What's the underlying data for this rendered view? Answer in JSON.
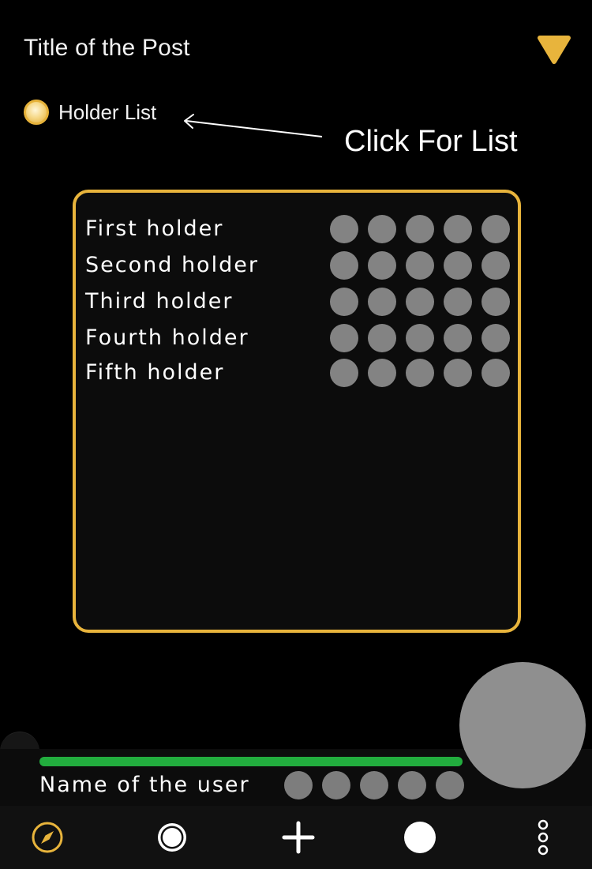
{
  "header": {
    "title": "Title of the Post",
    "dropdown_icon": "triangle-down-icon"
  },
  "holder_toggle": {
    "label": "Holder List",
    "checked": true
  },
  "callout": {
    "text": "Click For List"
  },
  "holders": [
    {
      "name": "First holder"
    },
    {
      "name": "Second holder"
    },
    {
      "name": "Third holder"
    },
    {
      "name": "Fourth holder"
    },
    {
      "name": "Fifth holder"
    }
  ],
  "user": {
    "name": "Name of the user",
    "progress": 1.0
  },
  "nav": [
    {
      "icon": "compass-icon"
    },
    {
      "icon": "ring-icon"
    },
    {
      "icon": "plus-icon"
    },
    {
      "icon": "filled-circle-icon"
    },
    {
      "icon": "more-vertical-icon"
    }
  ],
  "colors": {
    "accent": "#e8b43c",
    "progress": "#22ad3e",
    "dot": "#838383",
    "background": "#000000"
  }
}
